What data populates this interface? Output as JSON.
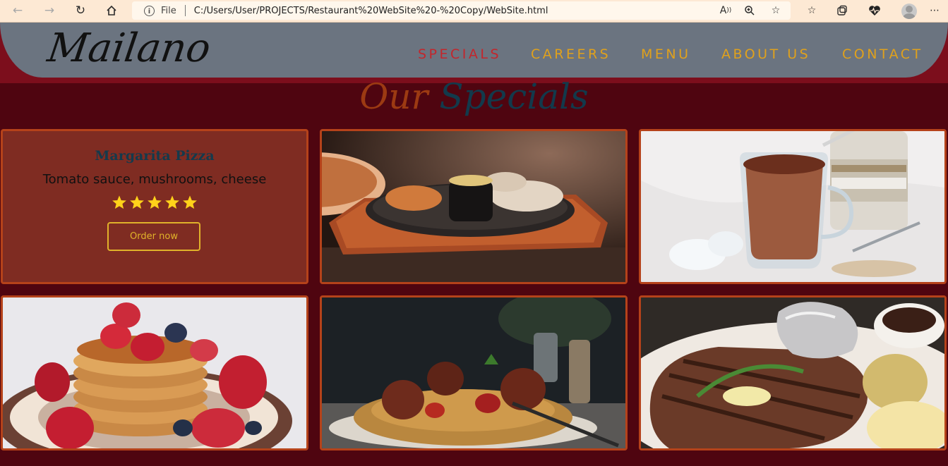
{
  "browser": {
    "scheme_label": "File",
    "url": "C:/Users/User/PROJECTS/Restaurant%20WebSite%20-%20Copy/WebSite.html"
  },
  "site": {
    "logo": "Mailano",
    "nav": [
      {
        "label": "SPECIALS",
        "active": true
      },
      {
        "label": "CAREERS",
        "active": false
      },
      {
        "label": "MENU",
        "active": false
      },
      {
        "label": "ABOUT US",
        "active": false
      },
      {
        "label": "CONTACT",
        "active": false
      }
    ]
  },
  "specials": {
    "title_part_1": "Our",
    "title_part_2": "Specials",
    "featured": {
      "name": "Margarita Pizza",
      "description": "Tomato sauce, mushrooms, cheese",
      "rating": 5,
      "button_label": "Order now"
    },
    "photos": [
      "sizzling grilled chicken platter",
      "chocolate protein drink",
      "pancakes with berries",
      "spaghetti and meatballs",
      "grilled steak with baked potato"
    ]
  },
  "colors": {
    "page_bg": "#4f0510",
    "header_bg": "#6b7480",
    "nav_link": "#e0a11c",
    "nav_active": "#c3262c",
    "card_bg": "#7f2c22",
    "card_border": "#b5421a",
    "star": "#ffd21a"
  }
}
